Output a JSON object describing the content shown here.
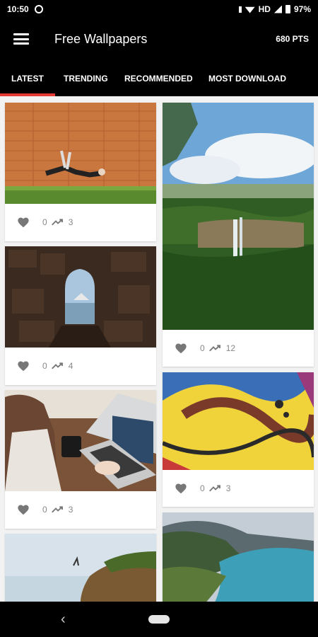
{
  "status": {
    "time": "10:50",
    "network": "HD",
    "battery": "97%"
  },
  "app": {
    "title": "Free Wallpapers",
    "points": "680 PTS"
  },
  "tabs": [
    "LATEST",
    "TRENDING",
    "RECOMMENDED",
    "MOST DOWNLOAD"
  ],
  "colors": {
    "accent": "#e53935",
    "bar": "#000000"
  },
  "cards": [
    {
      "likes": "0",
      "downloads": "3",
      "scene": "brick wall with levitating person"
    },
    {
      "likes": "0",
      "downloads": "12",
      "scene": "waterfall valley"
    },
    {
      "likes": "0",
      "downloads": "4",
      "scene": "stone wall window to sea"
    },
    {
      "likes": "0",
      "downloads": "3",
      "scene": "yellow graffiti"
    },
    {
      "likes": "0",
      "downloads": "3",
      "scene": "woman with coffee and laptop"
    },
    {
      "likes": "",
      "downloads": "",
      "scene": "coast cliff"
    },
    {
      "likes": "",
      "downloads": "",
      "scene": "mountain lake"
    }
  ],
  "icons": {
    "heart": "heart-icon",
    "trend": "trending-up-icon",
    "menu": "menu-icon",
    "back": "back-icon"
  }
}
